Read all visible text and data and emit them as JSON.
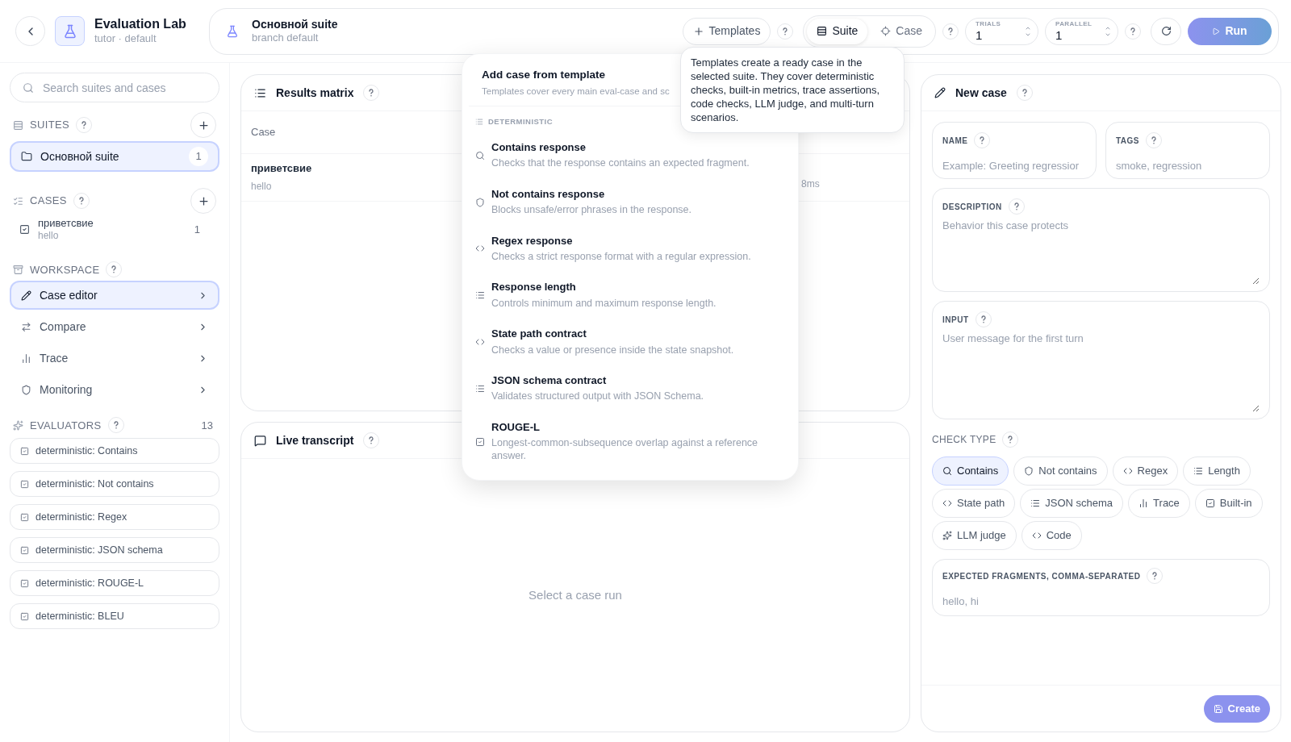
{
  "app": {
    "title": "Evaluation Lab",
    "subtitle": "tutor · default"
  },
  "suite_bar": {
    "title": "Основной suite",
    "subtitle": "branch default",
    "templates_button": "Templates",
    "mode_tabs": [
      {
        "label": "Suite",
        "kind": "suite",
        "selected": true
      },
      {
        "label": "Case",
        "kind": "case",
        "selected": false
      }
    ],
    "steppers": [
      {
        "label": "TRIALS",
        "value": "1"
      },
      {
        "label": "PARALLEL",
        "value": "1"
      }
    ],
    "run_button": "Run"
  },
  "sidebar": {
    "search_placeholder": "Search suites and cases",
    "suites": {
      "heading": "SUITES",
      "items": [
        {
          "name": "Основной suite",
          "count": "1",
          "selected": true
        }
      ]
    },
    "cases": {
      "heading": "CASES",
      "items": [
        {
          "name": "приветсвие",
          "subtitle": "hello",
          "count": "1"
        }
      ]
    },
    "workspace": {
      "heading": "WORKSPACE",
      "items": [
        {
          "label": "Case editor",
          "kind": "editor",
          "selected": true
        },
        {
          "label": "Compare",
          "kind": "compare",
          "selected": false
        },
        {
          "label": "Trace",
          "kind": "trace",
          "selected": false
        },
        {
          "label": "Monitoring",
          "kind": "monitoring",
          "selected": false
        }
      ]
    },
    "evaluators": {
      "heading": "EVALUATORS",
      "count": "13",
      "items": [
        "deterministic: Contains",
        "deterministic: Not contains",
        "deterministic: Regex",
        "deterministic: JSON schema",
        "deterministic: ROUGE-L",
        "deterministic: BLEU"
      ]
    }
  },
  "results_matrix": {
    "title": "Results matrix",
    "column_1": "Case",
    "rows": [
      {
        "case": "приветсвие",
        "input": "hello",
        "column_2": "8ms"
      }
    ]
  },
  "live_transcript": {
    "title": "Live transcript",
    "empty_text": "Select a case run"
  },
  "new_case": {
    "title": "New case",
    "fields": [
      {
        "label": "NAME",
        "placeholder": "Example: Greeting regressior",
        "kind": "input"
      },
      {
        "label": "TAGS",
        "placeholder": "smoke, regression",
        "kind": "input"
      },
      {
        "label": "DESCRIPTION",
        "placeholder": "Behavior this case protects",
        "kind": "textarea"
      },
      {
        "label": "INPUT",
        "placeholder": "User message for the first turn",
        "kind": "textarea"
      }
    ],
    "check_type": {
      "label": "CHECK TYPE",
      "options": [
        {
          "label": "Contains",
          "kind": "contains",
          "selected": true
        },
        {
          "label": "Not contains",
          "kind": "not_contains",
          "selected": false
        },
        {
          "label": "Regex",
          "kind": "regex",
          "selected": false
        },
        {
          "label": "Length",
          "kind": "length",
          "selected": false
        },
        {
          "label": "State path",
          "kind": "state_path",
          "selected": false
        },
        {
          "label": "JSON schema",
          "kind": "json_schema",
          "selected": false
        },
        {
          "label": "Trace",
          "kind": "trace",
          "selected": false
        },
        {
          "label": "Built-in",
          "kind": "builtin",
          "selected": false
        },
        {
          "label": "LLM judge",
          "kind": "llm_judge",
          "selected": false
        },
        {
          "label": "Code",
          "kind": "code",
          "selected": false
        }
      ]
    },
    "expected": {
      "label": "EXPECTED FRAGMENTS, COMMA-SEPARATED",
      "placeholder": "hello, hi"
    },
    "create_button": "Create"
  },
  "template_menu": {
    "title": "Add case from template",
    "subtitle": "Templates cover every main eval-case and sc",
    "group": "DETERMINISTIC",
    "items": [
      {
        "title": "Contains response",
        "description": "Checks that the response contains an expected fragment.",
        "kind": "contains"
      },
      {
        "title": "Not contains response",
        "description": "Blocks unsafe/error phrases in the response.",
        "kind": "not_contains"
      },
      {
        "title": "Regex response",
        "description": "Checks a strict response format with a regular expression.",
        "kind": "regex"
      },
      {
        "title": "Response length",
        "description": "Controls minimum and maximum response length.",
        "kind": "length"
      },
      {
        "title": "State path contract",
        "description": "Checks a value or presence inside the state snapshot.",
        "kind": "state_path"
      },
      {
        "title": "JSON schema contract",
        "description": "Validates structured output with JSON Schema.",
        "kind": "json_schema"
      },
      {
        "title": "ROUGE-L",
        "description": "Longest-common-subsequence overlap against a reference answer.",
        "kind": "builtin"
      }
    ]
  },
  "tooltip": "Templates create a ready case in the selected suite. They cover deterministic checks, built-in metrics, trace assertions, code checks, LLM judge, and multi-turn scenarios."
}
